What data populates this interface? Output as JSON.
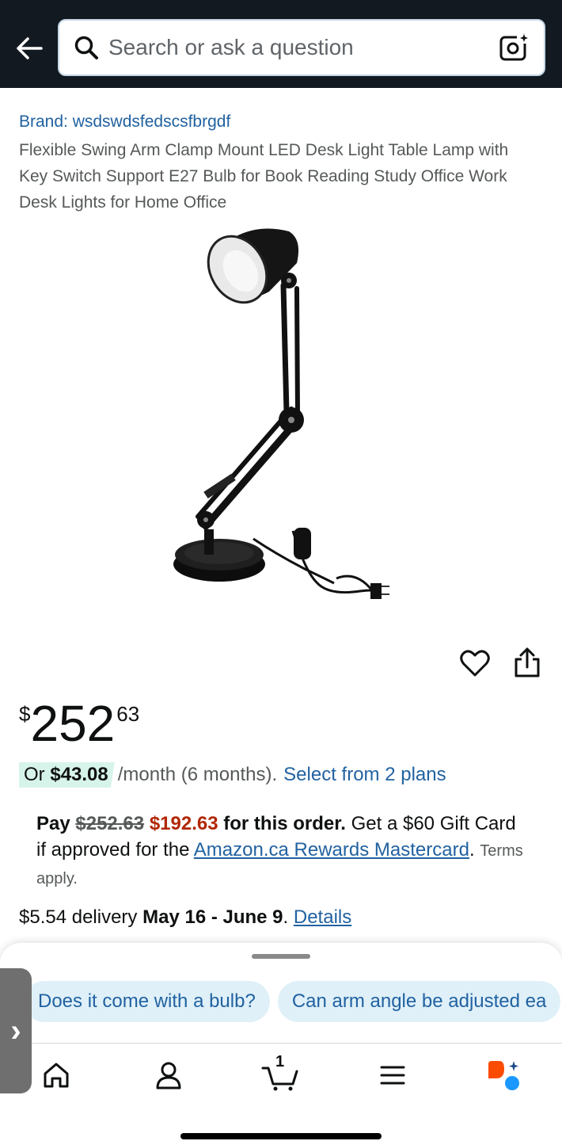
{
  "header": {
    "search_placeholder": "Search or ask a question"
  },
  "product": {
    "brand": "Brand: wsdswdsfedscsfbrgdf",
    "title": "Flexible Swing Arm Clamp Mount LED Desk Light Table Lamp with Key Switch Support E27 Bulb for Book Reading Study Office Work Desk Lights for Home Office"
  },
  "price": {
    "symbol": "$",
    "whole": "252",
    "fraction": "63"
  },
  "monthly": {
    "prefix": "Or",
    "amount": "$43.08",
    "rest": "/month (6 months).",
    "link": "Select from 2 plans"
  },
  "promo": {
    "pay": "Pay",
    "old_price": "$252.63",
    "new_price": "$192.63",
    "order_text": "for this order.",
    "gift_text": "Get a $60 Gift Card if approved for the",
    "card_link": "Amazon.ca Rewards Mastercard",
    "terms": "Terms apply."
  },
  "delivery": {
    "cost": "$5.54 delivery",
    "dates": "May 16 - June 9",
    "link": "Details"
  },
  "chips": [
    "Does it come with a bulb?",
    "Can arm angle be adjusted ea"
  ],
  "nav": {
    "cart_count": "1"
  },
  "colors": {
    "header_bg": "#131921",
    "link": "#2162a1",
    "deal_price": "#b12704",
    "badge_bg": "#d7f4ea",
    "chip_bg": "#dff0f8"
  }
}
